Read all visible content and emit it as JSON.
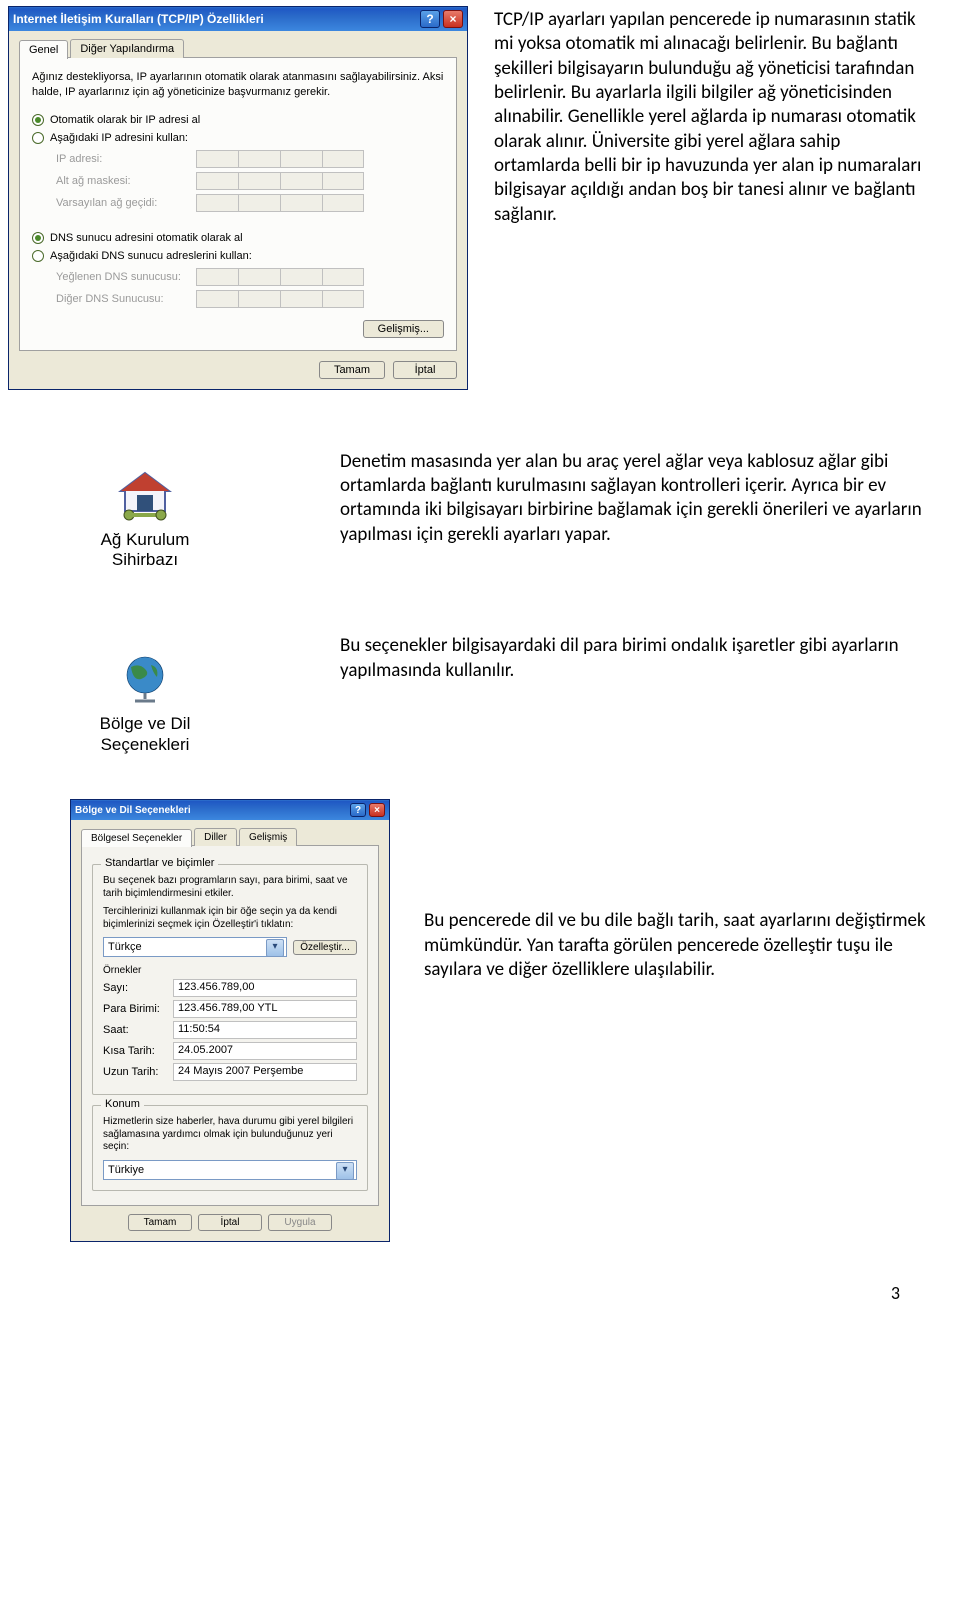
{
  "tcpip_dialog": {
    "title": "Internet İletişim Kuralları (TCP/IP) Özellikleri",
    "tabs": [
      "Genel",
      "Diğer Yapılandırma"
    ],
    "intro": "Ağınız destekliyorsa, IP ayarlarının otomatik olarak atanmasını sağlayabilirsiniz. Aksi halde, IP ayarlarınız için ağ yöneticinize başvurmanız gerekir.",
    "radio_ip_auto": "Otomatik olarak bir IP adresi al",
    "radio_ip_manual": "Aşağıdaki IP adresini kullan:",
    "label_ip": "IP adresi:",
    "label_mask": "Alt ağ maskesi:",
    "label_gateway": "Varsayılan ağ geçidi:",
    "radio_dns_auto": "DNS sunucu adresini otomatik olarak al",
    "radio_dns_manual": "Aşağıdaki DNS sunucu adreslerini kullan:",
    "label_dns1": "Yeğlenen DNS sunucusu:",
    "label_dns2": "Diğer DNS Sunucusu:",
    "btn_advanced": "Gelişmiş...",
    "btn_ok": "Tamam",
    "btn_cancel": "İptal"
  },
  "paragraphs": {
    "p1": "TCP/IP ayarları yapılan pencerede ip numarasının statik mi yoksa otomatik mi alınacağı belirlenir. Bu bağlantı şekilleri bilgisayarın bulunduğu ağ yöneticisi tarafından belirlenir. Bu ayarlarla ilgili bilgiler ağ yöneticisinden alınabilir. Genellikle yerel ağlarda ip numarası otomatik olarak alınır. Üniversite gibi yerel ağlara sahip ortamlarda belli bir ip havuzunda yer alan ip numaraları bilgisayar açıldığı andan boş bir tanesi alınır ve bağlantı sağlanır.",
    "p2": "Denetim masasında yer alan bu araç yerel ağlar veya kablosuz ağlar gibi ortamlarda bağlantı kurulmasını sağlayan kontrolleri içerir. Ayrıca bir ev ortamında iki bilgisayarı birbirine bağlamak için gerekli önerileri ve ayarların yapılması için gerekli ayarları yapar.",
    "p3": "Bu seçenekler bilgisayardaki dil para birimi ondalık işaretler gibi ayarların yapılmasında kullanılır.",
    "p4": "Bu pencerede dil ve bu dile bağlı tarih, saat ayarlarını değiştirmek mümkündür. Yan tarafta görülen pencerede özelleştir tuşu ile sayılara ve diğer özelliklere ulaşılabilir."
  },
  "cpl_icons": {
    "network_wizard": "Ağ Kurulum Sihirbazı",
    "regional": "Bölge ve Dil Seçenekleri"
  },
  "region_dialog": {
    "title": "Bölge ve Dil Seçenekleri",
    "tabs": [
      "Bölgesel Seçenekler",
      "Diller",
      "Gelişmiş"
    ],
    "group_formats": "Standartlar ve biçimler",
    "formats_intro1": "Bu seçenek bazı programların sayı, para birimi, saat ve tarih biçimlendirmesini etkiler.",
    "formats_intro2": "Tercihlerinizi kullanmak için bir öğe seçin ya da kendi biçimlerinizi seçmek için Özelleştir'i tıklatın:",
    "lang_value": "Türkçe",
    "btn_customize": "Özelleştir...",
    "examples_title": "Örnekler",
    "kv": {
      "sayi_k": "Sayı:",
      "sayi_v": "123.456.789,00",
      "para_k": "Para Birimi:",
      "para_v": "123.456.789,00 YTL",
      "saat_k": "Saat:",
      "saat_v": "11:50:54",
      "ksat_k": "Kısa Tarih:",
      "ksat_v": "24.05.2007",
      "ltar_k": "Uzun Tarih:",
      "ltar_v": "24 Mayıs 2007 Perşembe"
    },
    "group_location": "Konum",
    "location_intro": "Hizmetlerin size haberler, hava durumu gibi yerel bilgileri sağlamasına yardımcı olmak için bulunduğunuz yeri seçin:",
    "location_value": "Türkiye",
    "btn_ok": "Tamam",
    "btn_cancel": "İptal",
    "btn_apply": "Uygula"
  },
  "page_number": "3"
}
